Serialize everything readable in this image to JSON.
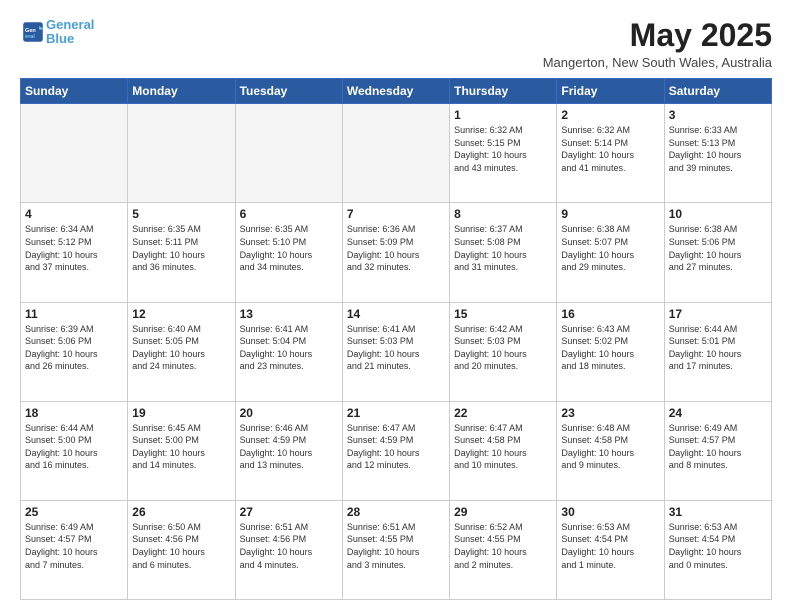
{
  "logo": {
    "line1": "General",
    "line2": "Blue"
  },
  "title": "May 2025",
  "location": "Mangerton, New South Wales, Australia",
  "days_header": [
    "Sunday",
    "Monday",
    "Tuesday",
    "Wednesday",
    "Thursday",
    "Friday",
    "Saturday"
  ],
  "weeks": [
    [
      {
        "day": "",
        "info": ""
      },
      {
        "day": "",
        "info": ""
      },
      {
        "day": "",
        "info": ""
      },
      {
        "day": "",
        "info": ""
      },
      {
        "day": "1",
        "info": "Sunrise: 6:32 AM\nSunset: 5:15 PM\nDaylight: 10 hours\nand 43 minutes."
      },
      {
        "day": "2",
        "info": "Sunrise: 6:32 AM\nSunset: 5:14 PM\nDaylight: 10 hours\nand 41 minutes."
      },
      {
        "day": "3",
        "info": "Sunrise: 6:33 AM\nSunset: 5:13 PM\nDaylight: 10 hours\nand 39 minutes."
      }
    ],
    [
      {
        "day": "4",
        "info": "Sunrise: 6:34 AM\nSunset: 5:12 PM\nDaylight: 10 hours\nand 37 minutes."
      },
      {
        "day": "5",
        "info": "Sunrise: 6:35 AM\nSunset: 5:11 PM\nDaylight: 10 hours\nand 36 minutes."
      },
      {
        "day": "6",
        "info": "Sunrise: 6:35 AM\nSunset: 5:10 PM\nDaylight: 10 hours\nand 34 minutes."
      },
      {
        "day": "7",
        "info": "Sunrise: 6:36 AM\nSunset: 5:09 PM\nDaylight: 10 hours\nand 32 minutes."
      },
      {
        "day": "8",
        "info": "Sunrise: 6:37 AM\nSunset: 5:08 PM\nDaylight: 10 hours\nand 31 minutes."
      },
      {
        "day": "9",
        "info": "Sunrise: 6:38 AM\nSunset: 5:07 PM\nDaylight: 10 hours\nand 29 minutes."
      },
      {
        "day": "10",
        "info": "Sunrise: 6:38 AM\nSunset: 5:06 PM\nDaylight: 10 hours\nand 27 minutes."
      }
    ],
    [
      {
        "day": "11",
        "info": "Sunrise: 6:39 AM\nSunset: 5:06 PM\nDaylight: 10 hours\nand 26 minutes."
      },
      {
        "day": "12",
        "info": "Sunrise: 6:40 AM\nSunset: 5:05 PM\nDaylight: 10 hours\nand 24 minutes."
      },
      {
        "day": "13",
        "info": "Sunrise: 6:41 AM\nSunset: 5:04 PM\nDaylight: 10 hours\nand 23 minutes."
      },
      {
        "day": "14",
        "info": "Sunrise: 6:41 AM\nSunset: 5:03 PM\nDaylight: 10 hours\nand 21 minutes."
      },
      {
        "day": "15",
        "info": "Sunrise: 6:42 AM\nSunset: 5:03 PM\nDaylight: 10 hours\nand 20 minutes."
      },
      {
        "day": "16",
        "info": "Sunrise: 6:43 AM\nSunset: 5:02 PM\nDaylight: 10 hours\nand 18 minutes."
      },
      {
        "day": "17",
        "info": "Sunrise: 6:44 AM\nSunset: 5:01 PM\nDaylight: 10 hours\nand 17 minutes."
      }
    ],
    [
      {
        "day": "18",
        "info": "Sunrise: 6:44 AM\nSunset: 5:00 PM\nDaylight: 10 hours\nand 16 minutes."
      },
      {
        "day": "19",
        "info": "Sunrise: 6:45 AM\nSunset: 5:00 PM\nDaylight: 10 hours\nand 14 minutes."
      },
      {
        "day": "20",
        "info": "Sunrise: 6:46 AM\nSunset: 4:59 PM\nDaylight: 10 hours\nand 13 minutes."
      },
      {
        "day": "21",
        "info": "Sunrise: 6:47 AM\nSunset: 4:59 PM\nDaylight: 10 hours\nand 12 minutes."
      },
      {
        "day": "22",
        "info": "Sunrise: 6:47 AM\nSunset: 4:58 PM\nDaylight: 10 hours\nand 10 minutes."
      },
      {
        "day": "23",
        "info": "Sunrise: 6:48 AM\nSunset: 4:58 PM\nDaylight: 10 hours\nand 9 minutes."
      },
      {
        "day": "24",
        "info": "Sunrise: 6:49 AM\nSunset: 4:57 PM\nDaylight: 10 hours\nand 8 minutes."
      }
    ],
    [
      {
        "day": "25",
        "info": "Sunrise: 6:49 AM\nSunset: 4:57 PM\nDaylight: 10 hours\nand 7 minutes."
      },
      {
        "day": "26",
        "info": "Sunrise: 6:50 AM\nSunset: 4:56 PM\nDaylight: 10 hours\nand 6 minutes."
      },
      {
        "day": "27",
        "info": "Sunrise: 6:51 AM\nSunset: 4:56 PM\nDaylight: 10 hours\nand 4 minutes."
      },
      {
        "day": "28",
        "info": "Sunrise: 6:51 AM\nSunset: 4:55 PM\nDaylight: 10 hours\nand 3 minutes."
      },
      {
        "day": "29",
        "info": "Sunrise: 6:52 AM\nSunset: 4:55 PM\nDaylight: 10 hours\nand 2 minutes."
      },
      {
        "day": "30",
        "info": "Sunrise: 6:53 AM\nSunset: 4:54 PM\nDaylight: 10 hours\nand 1 minute."
      },
      {
        "day": "31",
        "info": "Sunrise: 6:53 AM\nSunset: 4:54 PM\nDaylight: 10 hours\nand 0 minutes."
      }
    ]
  ]
}
